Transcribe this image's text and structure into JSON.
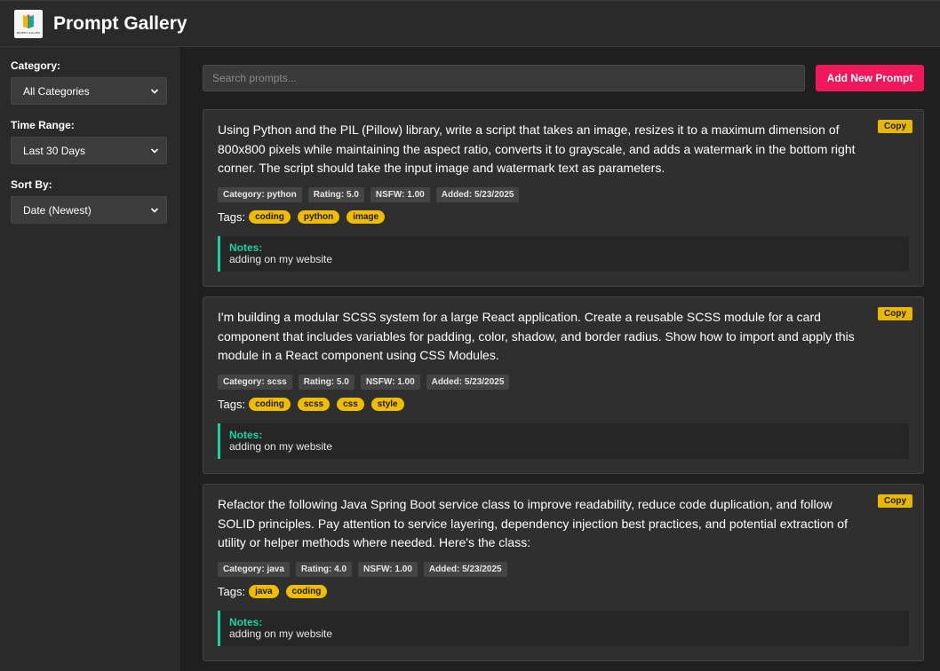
{
  "app": {
    "title": "Prompt Gallery",
    "logo_caption": "PROMPT GALLERY"
  },
  "sidebar": {
    "category": {
      "label": "Category:",
      "value": "All Categories"
    },
    "time_range": {
      "label": "Time Range:",
      "value": "Last 30 Days"
    },
    "sort_by": {
      "label": "Sort By:",
      "value": "Date (Newest)"
    }
  },
  "toolbar": {
    "search_placeholder": "Search prompts...",
    "add_button": "Add New Prompt"
  },
  "cards": [
    {
      "text": "Using Python and the PIL (Pillow) library, write a script that takes an image, resizes it to a maximum dimension of 800x800 pixels while maintaining the aspect ratio, converts it to grayscale, and adds a watermark in the bottom right corner. The script should take the input image and watermark text as parameters.",
      "copy": "Copy",
      "meta": [
        "Category: python",
        "Rating: 5.0",
        "NSFW: 1.00",
        "Added: 5/23/2025"
      ],
      "tags_label": "Tags:",
      "tags": [
        "coding",
        "python",
        "image"
      ],
      "notes_label": "Notes:",
      "notes": "adding on my website"
    },
    {
      "text": "I'm building a modular SCSS system for a large React application. Create a reusable SCSS module for a card component that includes variables for padding, color, shadow, and border radius. Show how to import and apply this module in a React component using CSS Modules.",
      "copy": "Copy",
      "meta": [
        "Category: scss",
        "Rating: 5.0",
        "NSFW: 1.00",
        "Added: 5/23/2025"
      ],
      "tags_label": "Tags:",
      "tags": [
        "coding",
        "scss",
        "css",
        "style"
      ],
      "notes_label": "Notes:",
      "notes": "adding on my website"
    },
    {
      "text": "Refactor the following Java Spring Boot service class to improve readability, reduce code duplication, and follow SOLID principles. Pay attention to service layering, dependency injection best practices, and potential extraction of utility or helper methods where needed. Here's the class:",
      "copy": "Copy",
      "meta": [
        "Category: java",
        "Rating: 4.0",
        "NSFW: 1.00",
        "Added: 5/23/2025"
      ],
      "tags_label": "Tags:",
      "tags": [
        "java",
        "coding"
      ],
      "notes_label": "Notes:",
      "notes": "adding on my website"
    }
  ],
  "colors": {
    "accent": "#f0185a",
    "tag": "#f0bc00",
    "notes_border": "#1dd1a1"
  }
}
